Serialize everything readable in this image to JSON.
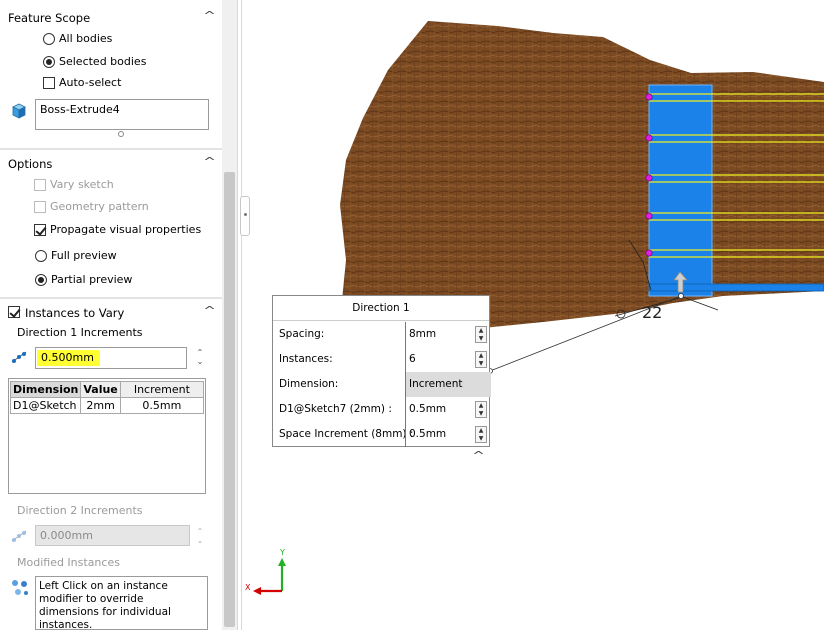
{
  "feature_scope": {
    "title": "Feature Scope",
    "all_bodies": "All bodies",
    "selected_bodies": "Selected bodies",
    "auto_select": "Auto-select",
    "body_item": "Boss-Extrude4"
  },
  "options": {
    "title": "Options",
    "vary_sketch": "Vary sketch",
    "geometry_pattern": "Geometry pattern",
    "propagate": "Propagate visual properties",
    "full_preview": "Full preview",
    "partial_preview": "Partial preview"
  },
  "instances_to_vary": {
    "title": "Instances to Vary",
    "dir1_label": "Direction 1 Increments",
    "dir1_value": "0.500mm",
    "table": {
      "headers": [
        "Dimension",
        "Value",
        "Increment"
      ],
      "rows": [
        [
          "D1@Sketch",
          "2mm",
          "0.5mm"
        ]
      ]
    },
    "dir2_label": "Direction 2 Increments",
    "dir2_value": "0.000mm",
    "modified_label": "Modified Instances",
    "hint": "Left Click on an instance modifier to override dimensions for individual instances."
  },
  "popup": {
    "title": "Direction 1",
    "rows": [
      {
        "label": "Spacing:",
        "value": "8mm"
      },
      {
        "label": "Instances:",
        "value": "6"
      },
      {
        "label": "Dimension:",
        "value": "Increment"
      },
      {
        "label": "D1@Sketch7 (2mm) :",
        "value": "0.5mm"
      },
      {
        "label": "Space Increment (8mm) :",
        "value": "0.5mm"
      }
    ]
  },
  "viewport": {
    "dim_text": "22",
    "axis_x": "X",
    "axis_y": "Y"
  },
  "colors": {
    "highlight": "#ffff33",
    "body_blue": "#1a82e8",
    "wood": "#7a4a22",
    "edge_yellow": "#f0f020",
    "point_magenta": "#e020e0",
    "axis_red": "#d40000",
    "axis_green": "#24b024"
  }
}
